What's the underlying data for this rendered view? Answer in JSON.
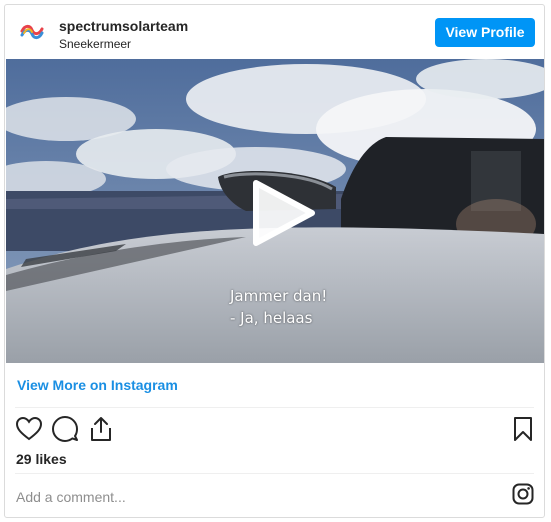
{
  "header": {
    "username": "spectrumsolarteam",
    "location": "Sneekermeer",
    "view_profile_label": "View Profile"
  },
  "media": {
    "subtitle_line1": "Jammer dan!",
    "subtitle_line2": "- Ja, helaas"
  },
  "view_more_label": "View More on Instagram",
  "likes": "29 likes",
  "comment": {
    "placeholder": "Add a comment..."
  },
  "colors": {
    "accent": "#0095f6",
    "link": "#1a8fe3",
    "text": "#262626",
    "muted": "#8e8e8e",
    "border": "#dbdbdb"
  },
  "icons": [
    "avatar-logo",
    "play-icon",
    "heart-icon",
    "comment-icon",
    "share-icon",
    "bookmark-icon",
    "instagram-icon"
  ]
}
